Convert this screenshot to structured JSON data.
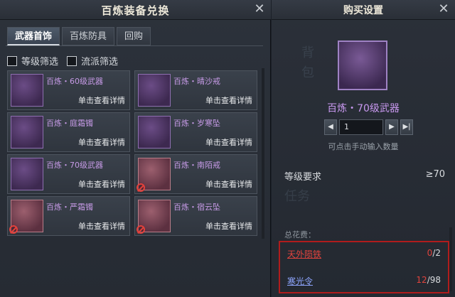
{
  "left": {
    "title": "百炼装备兑换",
    "tabs": [
      "武器首饰",
      "百炼防具",
      "回购"
    ],
    "filters": [
      "等级筛选",
      "流派筛选"
    ],
    "items": [
      {
        "name": "百炼・60级武器",
        "detail": "单击查看详情",
        "locked": false
      },
      {
        "name": "百炼・晴沙戒",
        "detail": "单击查看详情",
        "locked": false
      },
      {
        "name": "百炼・庭霜镯",
        "detail": "单击查看详情",
        "locked": false
      },
      {
        "name": "百炼・岁寒坠",
        "detail": "单击查看详情",
        "locked": false
      },
      {
        "name": "百炼・70级武器",
        "detail": "单击查看详情",
        "locked": false
      },
      {
        "name": "百炼・南陌戒",
        "detail": "单击查看详情",
        "locked": true
      },
      {
        "name": "百炼・严霜镯",
        "detail": "单击查看详情",
        "locked": true
      },
      {
        "name": "百炼・宿云坠",
        "detail": "单击查看详情",
        "locked": true
      }
    ]
  },
  "right": {
    "title": "购买设置",
    "item_name": "百炼・70级武器",
    "quantity": "1",
    "hint": "可点击手动输入数量",
    "requirement_label": "等级要求",
    "requirement_value": "≥70",
    "cost_label": "总花费：",
    "costs": [
      {
        "name": "天外陨铁",
        "have": "0",
        "need": "/2"
      },
      {
        "name": "寒光令",
        "have": "12",
        "need": "/98"
      }
    ],
    "background_glyphs": [
      "背",
      "包",
      "任务"
    ]
  },
  "colors": {
    "accent_purple": "#c898ef",
    "warning_red": "#e0433d",
    "link_blue": "#8ea6ff",
    "highlight_box": "#b01c1c"
  }
}
